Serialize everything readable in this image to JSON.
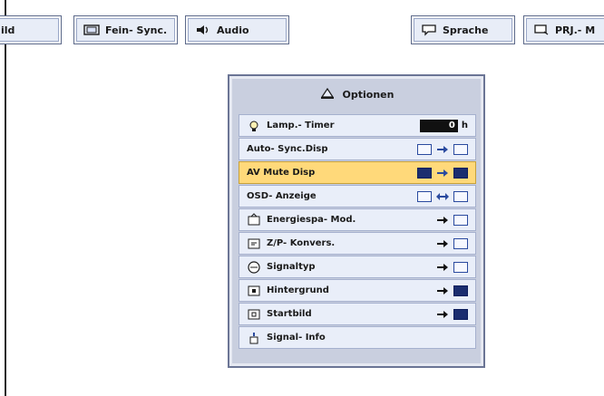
{
  "top_tabs": {
    "bild": {
      "label": "ild"
    },
    "fein_sync": {
      "label": "Fein- Sync."
    },
    "audio": {
      "label": "Audio"
    },
    "sprache": {
      "label": "Sprache"
    },
    "prj_mode": {
      "label": "PRJ.- M"
    }
  },
  "options_panel": {
    "title": "Optionen",
    "rows": [
      {
        "label": "Lamp.- Timer",
        "value": "0",
        "unit": "h"
      },
      {
        "label": "Auto- Sync.Disp"
      },
      {
        "label": "AV Mute Disp"
      },
      {
        "label": "OSD- Anzeige"
      },
      {
        "label": "Energiespa- Mod."
      },
      {
        "label": "Z/P- Konvers."
      },
      {
        "label": "Signaltyp"
      },
      {
        "label": "Hintergrund"
      },
      {
        "label": "Startbild"
      },
      {
        "label": "Signal- Info"
      }
    ]
  },
  "colors": {
    "selection": "#ffd97a",
    "panel_bg": "#c9cfdf",
    "row_bg": "#e9eef9",
    "tab_bg": "#e8edf7",
    "accent_blue": "#1b2d6f"
  },
  "icons": {
    "fein_sync": "sync-screen-icon",
    "audio": "speaker-icon",
    "sprache": "speech-bubble-icon",
    "prj": "projector-monitor-icon",
    "optionen": "options-panel-icon",
    "lamp_timer": "lamp-icon",
    "energiespar": "power-save-icon",
    "zp": "zoom-pan-icon",
    "signaltyp": "signal-type-icon",
    "hintergrund": "background-icon",
    "startbild": "startup-image-icon",
    "signal_info": "signal-info-icon"
  }
}
